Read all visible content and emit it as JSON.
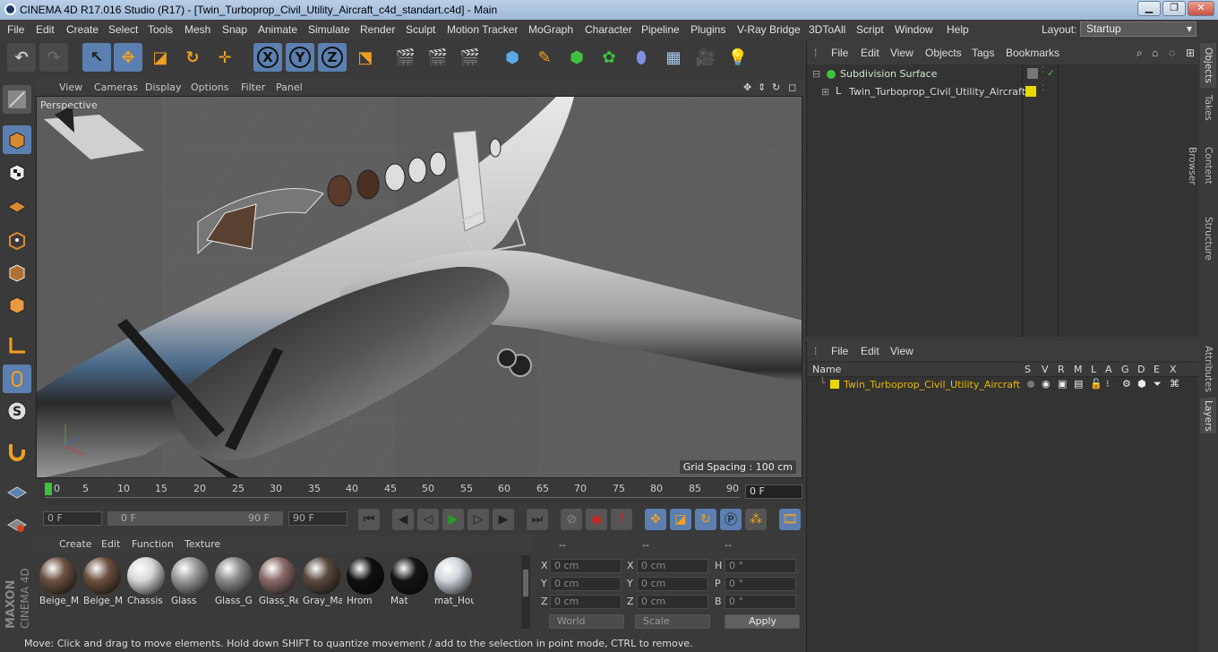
{
  "window": {
    "title": "CINEMA 4D R17.016 Studio (R17) - [Twin_Turboprop_Civil_Utility_Aircraft_c4d_standart.c4d] - Main"
  },
  "menubar": {
    "items": [
      "File",
      "Edit",
      "Create",
      "Select",
      "Tools",
      "Mesh",
      "Snap",
      "Animate",
      "Simulate",
      "Render",
      "Sculpt",
      "Motion Tracker",
      "MoGraph",
      "Character",
      "Pipeline",
      "Plugins",
      "V-Ray Bridge",
      "3DToAll",
      "Script",
      "Window",
      "Help"
    ],
    "layout_label": "Layout:",
    "layout_value": "Startup"
  },
  "viewport": {
    "menu": [
      "View",
      "Cameras",
      "Display",
      "Options",
      "Filter",
      "Panel"
    ],
    "camera_label": "Perspective",
    "grid_spacing": "Grid Spacing : 100 cm"
  },
  "timeline": {
    "ticks": [
      "0",
      "5",
      "10",
      "15",
      "20",
      "25",
      "30",
      "35",
      "40",
      "45",
      "50",
      "55",
      "60",
      "65",
      "70",
      "75",
      "80",
      "85",
      "90"
    ],
    "current_frame": "0 F"
  },
  "playback": {
    "start_field": "0 F",
    "range_start": "0 F",
    "range_end": "90 F",
    "end_field": "90 F"
  },
  "materials": {
    "menu": [
      "Create",
      "Edit",
      "Function",
      "Texture"
    ],
    "items": [
      {
        "name": "Beige_M",
        "color": "#6b5040"
      },
      {
        "name": "Beige_M",
        "color": "#6b5040"
      },
      {
        "name": "Chassis",
        "color": "#d8d8d8"
      },
      {
        "name": "Glass",
        "color": "#9a9a9a"
      },
      {
        "name": "Glass_G",
        "color": "#8a8a8a"
      },
      {
        "name": "Glass_Re",
        "color": "#8a6a6a"
      },
      {
        "name": "Gray_Ma",
        "color": "#5a4a40"
      },
      {
        "name": "Hrom",
        "color": "#101010"
      },
      {
        "name": "Mat",
        "color": "#151515"
      },
      {
        "name": "mat_Hou",
        "color": "#cfd6dc"
      }
    ]
  },
  "coordinates": {
    "headers": [
      "--",
      "--",
      "--"
    ],
    "rows": [
      {
        "l1": "X",
        "v1": "0 cm",
        "l2": "X",
        "v2": "0 cm",
        "l3": "H",
        "v3": "0 °"
      },
      {
        "l1": "Y",
        "v1": "0 cm",
        "l2": "Y",
        "v2": "0 cm",
        "l3": "P",
        "v3": "0 °"
      },
      {
        "l1": "Z",
        "v1": "0 cm",
        "l2": "Z",
        "v2": "0 cm",
        "l3": "B",
        "v3": "0 °"
      }
    ],
    "mode_world": "World",
    "mode_scale": "Scale",
    "apply": "Apply"
  },
  "status": {
    "text": "Move: Click and drag to move elements. Hold down SHIFT to quantize movement / add to the selection in point mode, CTRL to remove."
  },
  "object_manager": {
    "menu": [
      "File",
      "Edit",
      "View",
      "Objects",
      "Tags",
      "Bookmarks"
    ],
    "objects": [
      {
        "name": "Subdivision Surface",
        "color": "#cfe8cf"
      },
      {
        "name": "Twin_Turboprop_Civil_Utility_Aircraft",
        "color": "#d8d8d8"
      }
    ]
  },
  "layer_manager": {
    "menu": [
      "File",
      "Edit",
      "View"
    ],
    "columns": [
      "Name",
      "S",
      "V",
      "R",
      "M",
      "L",
      "A",
      "G",
      "D",
      "E",
      "X"
    ],
    "layers": [
      {
        "name": "Twin_Turboprop_Civil_Utility_Aircraft",
        "color": "#e8b700"
      }
    ]
  },
  "right_tabs": [
    "Objects",
    "Takes",
    "Content Browser",
    "Structure",
    "Attributes",
    "Layers"
  ],
  "brand": {
    "line1": "MAXON",
    "line2": "CINEMA 4D"
  },
  "colors": {
    "accent": "#5b7fb0",
    "layer_yellow": "#e8d800",
    "layer_text": "#e8b700"
  }
}
